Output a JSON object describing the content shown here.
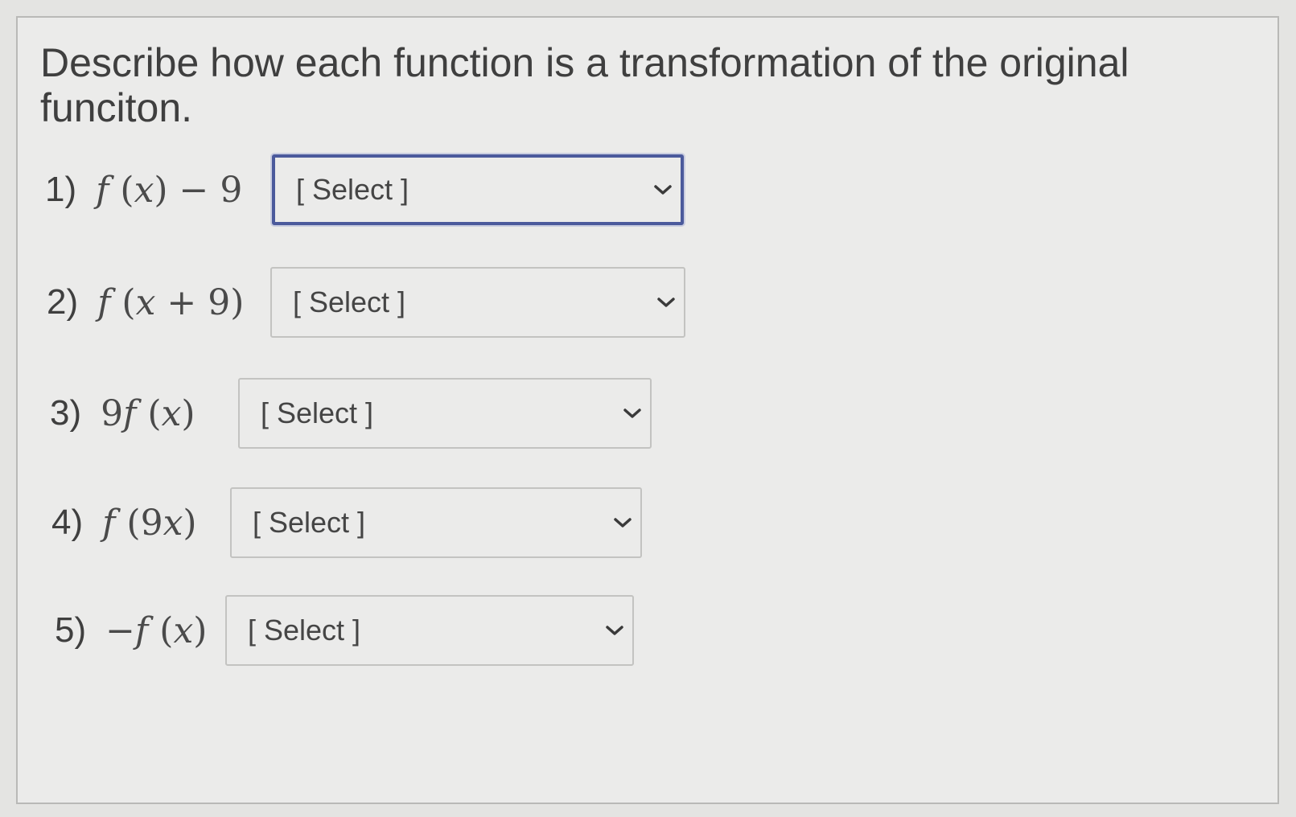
{
  "question": {
    "text": "Describe how each function is a  transformation of the original funciton."
  },
  "items": [
    {
      "number": "1)",
      "expression": [
        "f",
        " (",
        "x",
        ") − 9"
      ],
      "select_value": "[ Select ]"
    },
    {
      "number": "2)",
      "expression": [
        "f",
        " (",
        "x",
        " + 9)"
      ],
      "select_value": "[ Select ]"
    },
    {
      "number": "3)",
      "expression": [
        "9",
        "f",
        " (",
        "x",
        ")"
      ],
      "select_value": "[ Select ]"
    },
    {
      "number": "4)",
      "expression": [
        "f",
        " (9",
        "x",
        ")"
      ],
      "select_value": "[ Select ]"
    },
    {
      "number": "5)",
      "expression": [
        "−",
        "f",
        " (",
        "x",
        ")"
      ],
      "select_value": "[ Select ]"
    }
  ],
  "colors": {
    "focus_border": "#4b5a9c",
    "panel_background": "#ebebea"
  },
  "icons": {
    "dropdown": "chevron-down-icon"
  }
}
